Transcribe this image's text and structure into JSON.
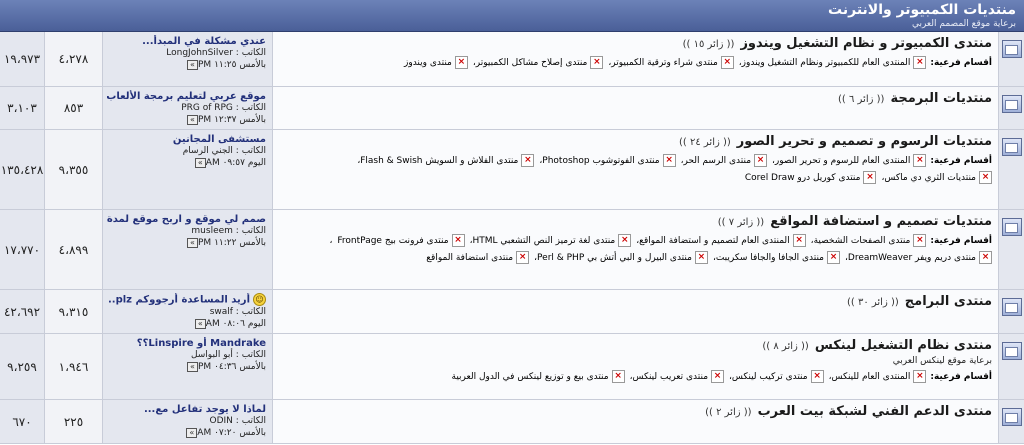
{
  "header": {
    "title": "منتديات الكمبيوتر والانترنت",
    "subtitle": "برعاية موقع المصمم العربي"
  },
  "labels": {
    "subs": "أقسام فرعية:",
    "author_prefix": "الكاتب :",
    "go": "»"
  },
  "forums": [
    {
      "title": "منتدى الكمبيوتر و نظام التشغيل ويندوز",
      "viewers": "(( زائر ١٥ ))",
      "desc": "",
      "subs": [
        "المنتدى العام للكمبيوتر ونظام التشغيل ويندوز،",
        "منتدى شراء وترقية الكمبيوتر،",
        "منتدى إصلاح مشاكل الكمبيوتر،",
        "منتدى ويندوز"
      ],
      "last": {
        "title": "عندي مشكلة في المبدأ...",
        "author": "LongJohnSilver",
        "time": "بالأمس ١١:٢٥ PM"
      },
      "threads": "٤،٢٧٨",
      "posts": "١٩،٩٧٣",
      "height": 55
    },
    {
      "title": "منتديات البرمجة",
      "viewers": "(( زائر ٦ ))",
      "desc": "",
      "subs": [],
      "last": {
        "title": "موقع عربي لتعليم برمجة الألعاب",
        "author": "PRG of RPG",
        "time": "بالأمس ١٢:٣٧ PM"
      },
      "threads": "٨٥٣",
      "posts": "٣،١٠٣",
      "height": 43
    },
    {
      "title": "منتديات الرسوم و تصميم و تحرير الصور",
      "viewers": "(( زائر ٢٤ ))",
      "desc": "",
      "subs": [
        "المنتدى العام للرسوم و تحرير الصور،",
        "منتدى الرسم الحر،",
        "منتدى الفوتوشوب Photoshop،",
        "منتدى الفلاش و السويش Flash & Swish،",
        "منتديات الثري دي ماكس،",
        "منتدى كوريل درو Corel Draw"
      ],
      "last": {
        "title": "مستشفى المجانين",
        "author": "الجني الرسام",
        "time": "اليوم ٠٩:٥٧ AM"
      },
      "threads": "٩،٣٥٥",
      "posts": "١٣٥،٤٢٨",
      "height": 80
    },
    {
      "title": "منتديات تصميم و استضافة المواقع",
      "viewers": "(( زائر ٧ ))",
      "desc": "",
      "subs": [
        "منتدى الصفحات الشخصية،",
        "المنتدى العام لتصميم و استضافة المواقع،",
        "منتدى لغة ترميز النص التشعبي HTML،",
        "منتدى فرونت بيج FrontPage",
        "،",
        "منتدى دريم ويفر DreamWeaver،",
        "منتدى الجافا والجافا سكريبت،",
        "منتدى البيرل و البي أتش بي Perl & PHP،",
        "منتدى استضافة المواقع"
      ],
      "last": {
        "title": "صمم لي موقع و اربح موقع لمدة...",
        "author": "musleem",
        "time": "بالأمس ١١:٢٢ PM"
      },
      "threads": "٤،٨٩٩",
      "posts": "١٧،٧٧٠",
      "height": 80
    },
    {
      "title": "منتدى البرامج",
      "viewers": "(( زائر ٣٠ ))",
      "desc": "",
      "subs": [],
      "last": {
        "title": "أريد المساعدة أرجووكم plz...",
        "author": "swalf",
        "time": "اليوم ٠٨:٠٦ AM",
        "smile": "☺"
      },
      "threads": "٩،٣١٥",
      "posts": "٤٢،٦٩٢",
      "height": 44
    },
    {
      "title": "منتدى نظام التشغيل لينكس",
      "viewers": "(( زائر ٨ ))",
      "desc": "برعاية موقع لينكس العربي",
      "subs": [
        "المنتدى العام للينكس،",
        "منتدى تركيب لينكس،",
        "منتدى تعريب لينكس،",
        "منتدى بيع و توزيع لينكس في الدول العربية"
      ],
      "last": {
        "title": "Mandrake أو Linspire؟؟",
        "author": "أبو البواسل",
        "time": "بالأمس ٠٤:٣٦ PM"
      },
      "threads": "١،٩٤٦",
      "posts": "٩،٢٥٩",
      "height": 66
    },
    {
      "title": "منتدى الدعم الفني لشبكة بيت العرب",
      "viewers": "(( زائر ٢ ))",
      "desc": "",
      "subs": [],
      "last": {
        "title": "لماذا لا يوجد تفاعل مع...",
        "author": "ODIN",
        "time": "بالأمس ٠٧:٢٠ AM"
      },
      "threads": "٢٢٥",
      "posts": "٦٧٠",
      "height": 44
    }
  ]
}
